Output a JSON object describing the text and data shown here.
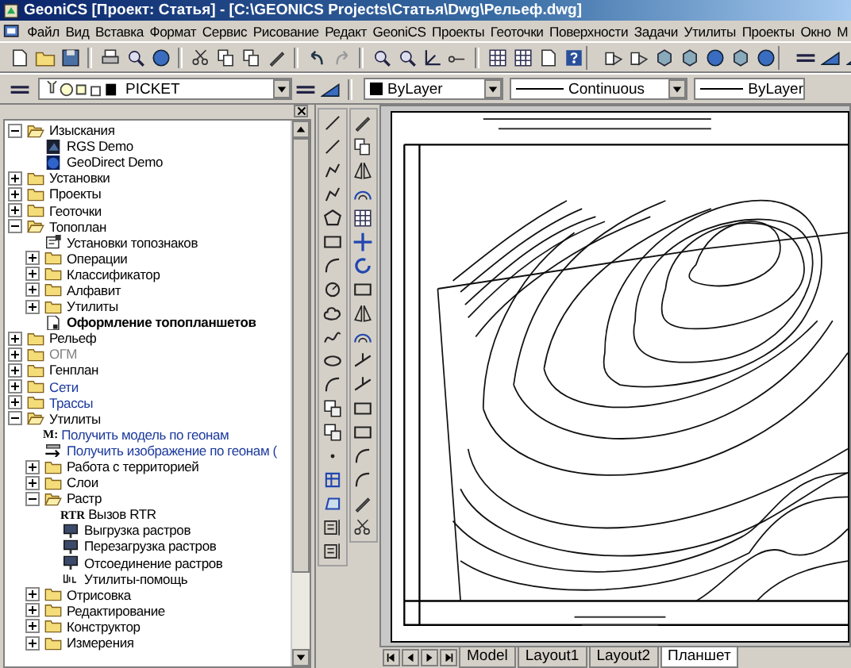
{
  "window": {
    "title": "GeoniCS [Проект: Статья] - [C:\\GEONICS Projects\\Статья\\Dwg\\Рельеф.dwg]"
  },
  "menu": [
    "Файл",
    "Вид",
    "Вставка",
    "Формат",
    "Сервис",
    "Рисование",
    "Редакт",
    "GeoniCS",
    "Проекты",
    "Геоточки",
    "Поверхности",
    "Задачи",
    "Утилиты",
    "Проекты",
    "Окно",
    "М"
  ],
  "layer_bar": {
    "layer": "PICKET",
    "color_name": "ByLayer",
    "linetype": "Continuous",
    "lineweight": "ByLayer"
  },
  "tree": [
    {
      "label": "Изыскания",
      "kind": "folder",
      "color": "#000000",
      "bold": false,
      "expanded": true,
      "children": [
        {
          "label": "RGS Demo",
          "kind": "demo",
          "color": "#000000",
          "bold": false
        },
        {
          "label": "GeoDirect Demo",
          "kind": "globe",
          "color": "#000000",
          "bold": false
        }
      ]
    },
    {
      "label": "Установки",
      "kind": "folder",
      "color": "#000000",
      "bold": false,
      "expanded": false
    },
    {
      "label": "Проекты",
      "kind": "folder",
      "color": "#000000",
      "bold": false,
      "expanded": false
    },
    {
      "label": "Геоточки",
      "kind": "folder",
      "color": "#000000",
      "bold": false,
      "expanded": false
    },
    {
      "label": "Топоплан",
      "kind": "folder",
      "color": "#000000",
      "bold": false,
      "expanded": true,
      "children": [
        {
          "label": "Установки топознаков",
          "kind": "settings",
          "color": "#000000",
          "bold": false
        },
        {
          "label": "Операции",
          "kind": "folder",
          "color": "#000000",
          "bold": false,
          "expanded": false
        },
        {
          "label": "Классификатор",
          "kind": "folder",
          "color": "#000000",
          "bold": false,
          "expanded": false
        },
        {
          "label": "Алфавит",
          "kind": "folder",
          "color": "#000000",
          "bold": false,
          "expanded": false
        },
        {
          "label": "Утилиты",
          "kind": "folder",
          "color": "#000000",
          "bold": false,
          "expanded": false
        },
        {
          "label": "Оформление топопланшетов",
          "kind": "document",
          "color": "#000000",
          "bold": true
        }
      ]
    },
    {
      "label": "Рельеф",
      "kind": "folder",
      "color": "#000000",
      "bold": false,
      "expanded": false
    },
    {
      "label": "ОГМ",
      "kind": "folder",
      "color": "#808080",
      "bold": false,
      "expanded": false
    },
    {
      "label": "Генплан",
      "kind": "folder",
      "color": "#000000",
      "bold": false,
      "expanded": false
    },
    {
      "label": "Сети",
      "kind": "folder",
      "color": "#1c3a9c",
      "bold": false,
      "expanded": false
    },
    {
      "label": "Трассы",
      "kind": "folder",
      "color": "#1c3a9c",
      "bold": false,
      "expanded": false
    },
    {
      "label": "Утилиты",
      "kind": "folder",
      "color": "#000000",
      "bold": false,
      "expanded": true,
      "children": [
        {
          "label": "Получить модель по геонам",
          "kind": "tag",
          "icon_text": "M:",
          "color": "#1c3a9c",
          "bold": false
        },
        {
          "label": "Получить изображение по геонам (",
          "kind": "arrow",
          "color": "#1c3a9c",
          "bold": false
        },
        {
          "label": "Работа с территорией",
          "kind": "folder",
          "color": "#000000",
          "bold": false,
          "expanded": false
        },
        {
          "label": "Слои",
          "kind": "folder",
          "color": "#000000",
          "bold": false,
          "expanded": false
        },
        {
          "label": "Растр",
          "kind": "folder",
          "color": "#000000",
          "bold": false,
          "expanded": true,
          "children": [
            {
              "label": "Вызов RTR",
              "kind": "tag",
              "icon_text": "RTR",
              "color": "#000000",
              "bold": false
            },
            {
              "label": "Выгрузка растров",
              "kind": "raster",
              "color": "#000000",
              "bold": false
            },
            {
              "label": "Перезагрузка растров",
              "kind": "raster",
              "color": "#000000",
              "bold": false
            },
            {
              "label": "Отсоединение растров",
              "kind": "raster",
              "color": "#000000",
              "bold": false
            },
            {
              "label": "Утилиты-помощь",
              "kind": "util",
              "color": "#000000",
              "bold": false
            }
          ]
        },
        {
          "label": "Отрисовка",
          "kind": "folder",
          "color": "#000000",
          "bold": false,
          "expanded": false
        },
        {
          "label": "Редактирование",
          "kind": "folder",
          "color": "#000000",
          "bold": false,
          "expanded": false
        },
        {
          "label": "Конструктор",
          "kind": "folder",
          "color": "#000000",
          "bold": false,
          "expanded": false
        },
        {
          "label": "Измерения",
          "kind": "folder",
          "color": "#000000",
          "bold": false,
          "expanded": false
        }
      ]
    }
  ],
  "sheet_tabs": [
    {
      "label": "Model",
      "selected": false
    },
    {
      "label": "Layout1",
      "selected": false
    },
    {
      "label": "Layout2",
      "selected": false
    },
    {
      "label": "Планшет",
      "selected": true
    }
  ]
}
